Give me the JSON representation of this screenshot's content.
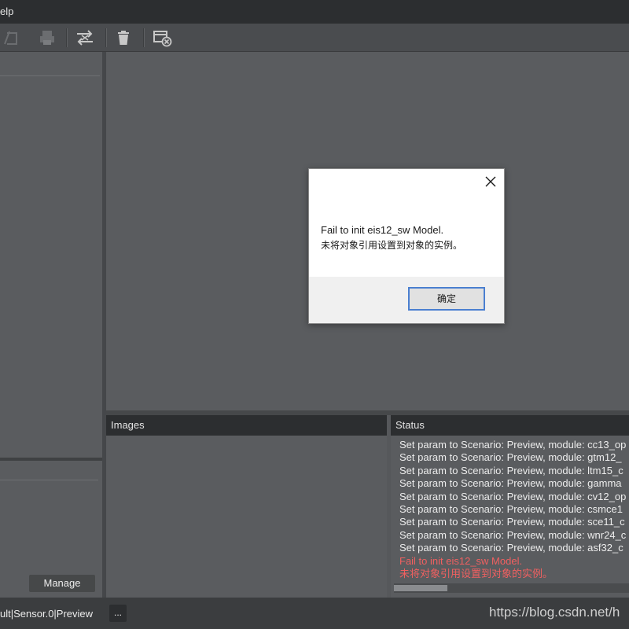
{
  "menubar": {
    "visible_label": "elp"
  },
  "toolbar": {
    "buttons": [
      {
        "icon": "save-icon"
      },
      {
        "icon": "print-icon"
      },
      {
        "icon": "compare-icon"
      },
      {
        "icon": "trash-icon"
      },
      {
        "icon": "close-window-icon"
      }
    ]
  },
  "left_panel": {
    "manage_label": "Manage"
  },
  "images_panel": {
    "title": "Images"
  },
  "status_panel": {
    "title": "Status",
    "lines": [
      {
        "text": "Set param to Scenario: Preview, module: cc13_op",
        "level": "info"
      },
      {
        "text": "Set param to Scenario: Preview, module: gtm12_",
        "level": "info"
      },
      {
        "text": "Set param to Scenario: Preview, module: ltm15_c",
        "level": "info"
      },
      {
        "text": "Set param to Scenario: Preview, module: gamma",
        "level": "info"
      },
      {
        "text": "Set param to Scenario: Preview, module: cv12_op",
        "level": "info"
      },
      {
        "text": "Set param to Scenario: Preview, module: csmce1",
        "level": "info"
      },
      {
        "text": "Set param to Scenario: Preview, module: sce11_c",
        "level": "info"
      },
      {
        "text": "Set param to Scenario: Preview, module: wnr24_c",
        "level": "info"
      },
      {
        "text": "Set param to Scenario: Preview, module: asf32_c",
        "level": "info"
      },
      {
        "text": "Fail to init eis12_sw Model.",
        "level": "error"
      },
      {
        "text": "未将对象引用设置到对象的实例。",
        "level": "error"
      }
    ]
  },
  "statusbar": {
    "path_text": "ult|Sensor.0|Preview",
    "more_label": "...",
    "watermark": "https://blog.csdn.net/h"
  },
  "dialog": {
    "message_line1": "Fail to init eis12_sw Model.",
    "message_line2": "未将对象引用设置到对象的实例。",
    "ok_label": "确定"
  },
  "colors": {
    "error_text": "#f06060",
    "dialog_button_border": "#4a7fd0",
    "panel_header": "#2c2e30"
  }
}
